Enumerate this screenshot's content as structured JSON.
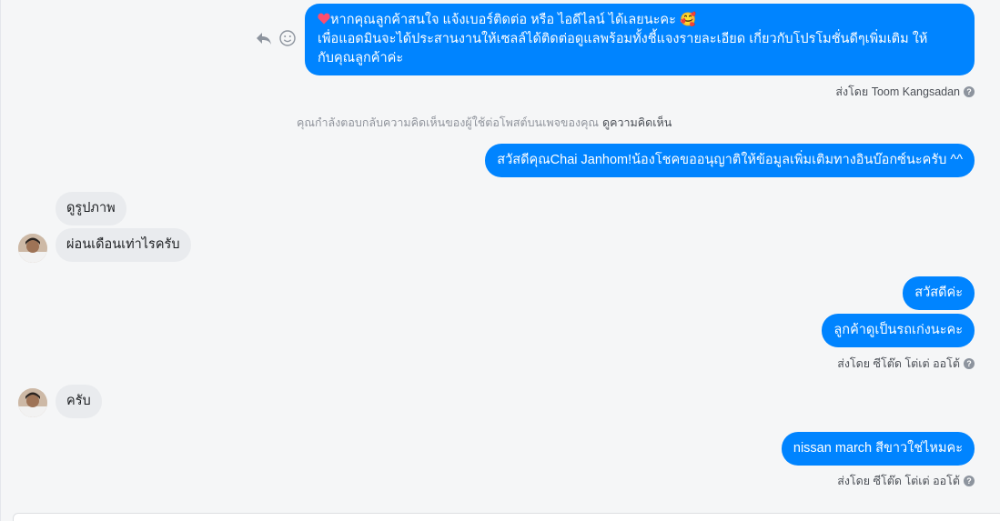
{
  "messages": {
    "promo": {
      "line1": "หากคุณลูกค้าสนใจ แจ้งเบอร์ติดต่อ หรือ ไอดีไลน์ ได้เลยนะคะ 🥰",
      "line2": "เพื่อแอดมินจะได้ประสานงานให้เซลล์ได้ติดต่อดูแลพร้อมทั้งชี้แจงรายละเอียด เกี่ยวกับโปรโมชั่นดีๆเพิ่มเติม ให้",
      "line3": "กับคุณลูกค้าค่ะ"
    },
    "sent_by_1": "ส่งโดย Toom Kangsadan",
    "notice_text": "คุณกำลังตอบกลับความคิดเห็นของผู้ใช้ต่อโพสต์บนเพจของคุณ",
    "notice_link": "ดูความคิดเห็น",
    "greeting": "สวัสดีคุณChai Janhom!น้องโชคขออนุญาติให้ข้อมูลเพิ่มเติมทางอินบ๊อกซ์นะครับ ^^",
    "in_view_image": "ดูรูปภาพ",
    "in_installment": "ผ่อนเดือนเท่าไรครับ",
    "out_hello": "สวัสดีค่ะ",
    "out_used_car": "ลูกค้าดูเป็นรถเก่งนะคะ",
    "sent_by_2": "ส่งโดย ซีโต๊ด โต่เต่ ออโต้",
    "in_yes": "ครับ",
    "out_nissan": "nissan march สีขาวใช่ไหมคะ",
    "sent_by_3": "ส่งโดย ซีโต๊ด โต่เต่ ออโต้"
  },
  "icons": {
    "reply": "reply-icon",
    "emoji": "smiley-icon",
    "help": "question-icon",
    "heart": "heart-icon"
  },
  "colors": {
    "outgoing_bubble": "#0084ff",
    "incoming_bubble": "#e9ebee"
  }
}
